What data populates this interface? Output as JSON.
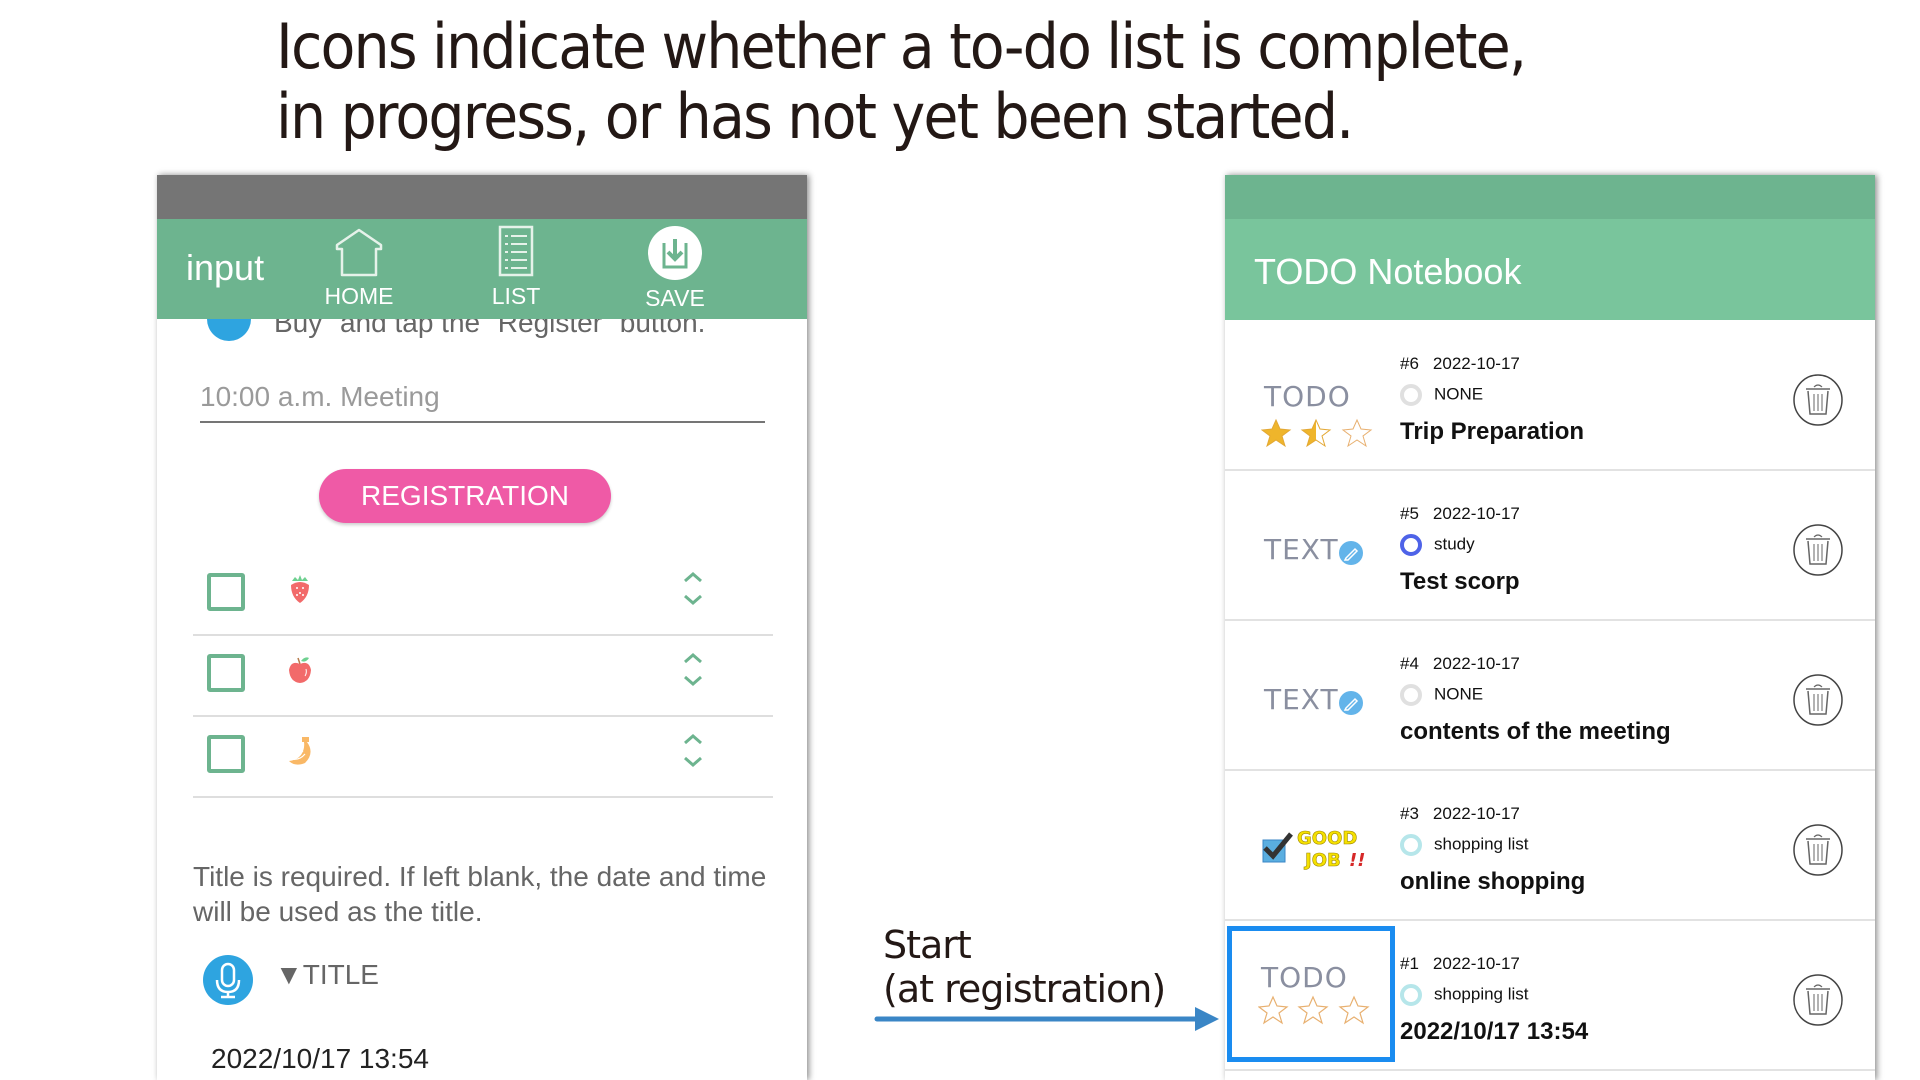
{
  "headline": {
    "line1": "Icons indicate whether a to-do list is complete,",
    "line2": "in progress, or has not yet been started."
  },
  "input_screen": {
    "title": "input",
    "toolbar": [
      {
        "label": "HOME",
        "icon": "home-icon"
      },
      {
        "label": "LIST",
        "icon": "list-icon"
      },
      {
        "label": "SAVE",
        "icon": "save-icon"
      }
    ],
    "hint_top": "Buy\" and tap the \"Register\" button.",
    "meeting_input_value": "10:00 a.m. Meeting",
    "registration_button": "REGISTRATION",
    "items": [
      {
        "icon": "strawberry-icon",
        "checked": false
      },
      {
        "icon": "apple-icon",
        "checked": false
      },
      {
        "icon": "banana-icon",
        "checked": false
      }
    ],
    "title_note": "Title is required. If left blank, the date and time will be used as the title.",
    "title_label": "▼TITLE",
    "title_value": "2022/10/17 13:54"
  },
  "annotation": {
    "line1": "Start",
    "line2": "(at registration)",
    "arrow_color": "#3a86c6"
  },
  "list_screen": {
    "title": "TODO Notebook",
    "rows": [
      {
        "num": "#6",
        "date": "2022-10-17",
        "category": "NONE",
        "title": "Trip Preparation",
        "status_icon": "TODO",
        "rating": 1.5,
        "ring_color": "#e0e0e0"
      },
      {
        "num": "#5",
        "date": "2022-10-17",
        "category": "study",
        "title": "Test scorp",
        "status_icon": "TEXT",
        "ring_color": "#4e63e8"
      },
      {
        "num": "#4",
        "date": "2022-10-17",
        "category": "NONE",
        "title": "contents of the meeting",
        "status_icon": "TEXT",
        "ring_color": "#e0e0e0"
      },
      {
        "num": "#3",
        "date": "2022-10-17",
        "category": "shopping list",
        "title": "online shopping",
        "status_icon": "GOOD JOB!!",
        "ring_color": "#b6e6ea"
      },
      {
        "num": "#1",
        "date": "2022-10-17",
        "category": "shopping list",
        "title": "2022/10/17 13:54",
        "status_icon": "TODO",
        "rating": 0,
        "ring_color": "#b6e6ea"
      }
    ]
  }
}
